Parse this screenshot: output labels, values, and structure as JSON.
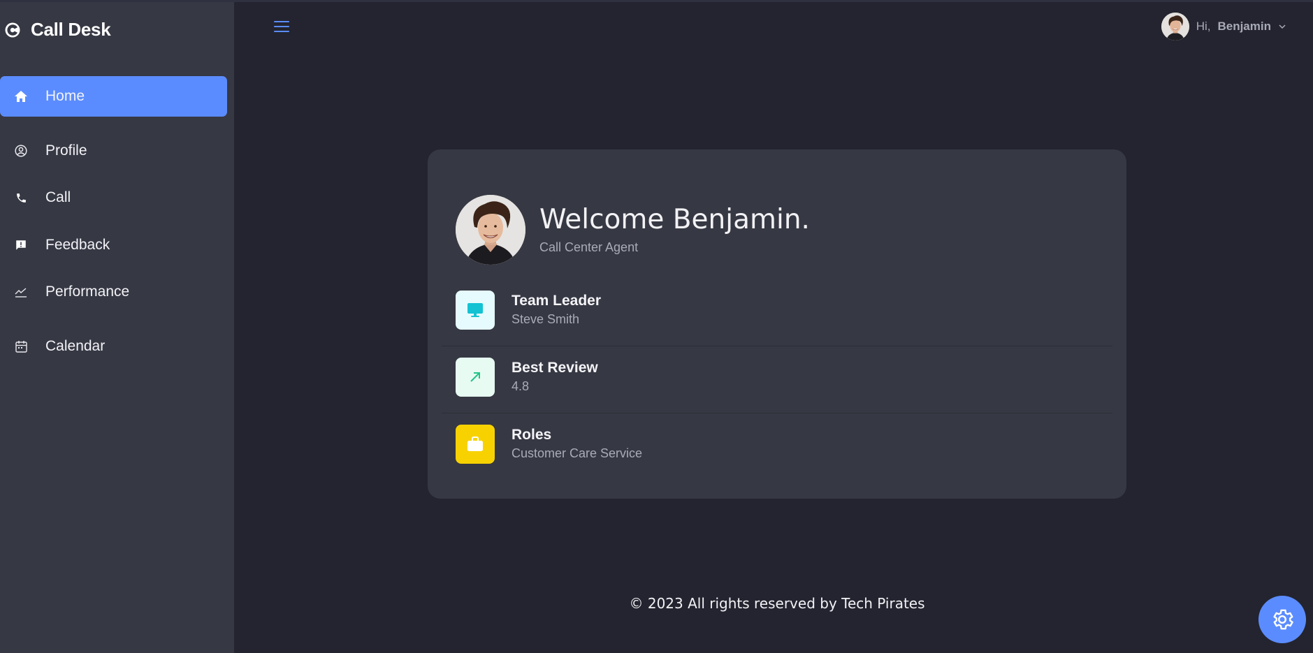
{
  "app": {
    "name": "Call Desk"
  },
  "sidebar": {
    "items": [
      {
        "label": "Home",
        "icon": "home-icon",
        "active": true
      },
      {
        "label": "Profile",
        "icon": "user-circle-icon"
      },
      {
        "label": "Call",
        "icon": "phone-icon"
      },
      {
        "label": "Feedback",
        "icon": "feedback-icon"
      },
      {
        "label": "Performance",
        "icon": "chart-line-icon"
      },
      {
        "label": "Calendar",
        "icon": "calendar-icon"
      }
    ]
  },
  "header": {
    "greeting": "Hi,",
    "user_name": "Benjamin"
  },
  "card": {
    "welcome_title": "Welcome Benjamin.",
    "welcome_subtitle": "Call Center Agent",
    "rows": [
      {
        "title": "Team Leader",
        "value": "Steve Smith",
        "icon": "monitor-icon",
        "tile_color": "#e6fbfd",
        "icon_color": "#13c3d3"
      },
      {
        "title": "Best Review",
        "value": "4.8",
        "icon": "trend-up-arrow-icon",
        "tile_color": "#e7fbf2",
        "icon_color": "#22c48a"
      },
      {
        "title": "Roles",
        "value": "Customer Care Service",
        "icon": "briefcase-icon",
        "tile_color": "#f7d200",
        "icon_color": "#ffffff"
      }
    ]
  },
  "footer": {
    "text": "© 2023 All rights reserved by Tech Pirates"
  },
  "colors": {
    "accent": "#5b8cff",
    "sidebar": "#363843",
    "background": "#23242f",
    "card": "#363843"
  }
}
